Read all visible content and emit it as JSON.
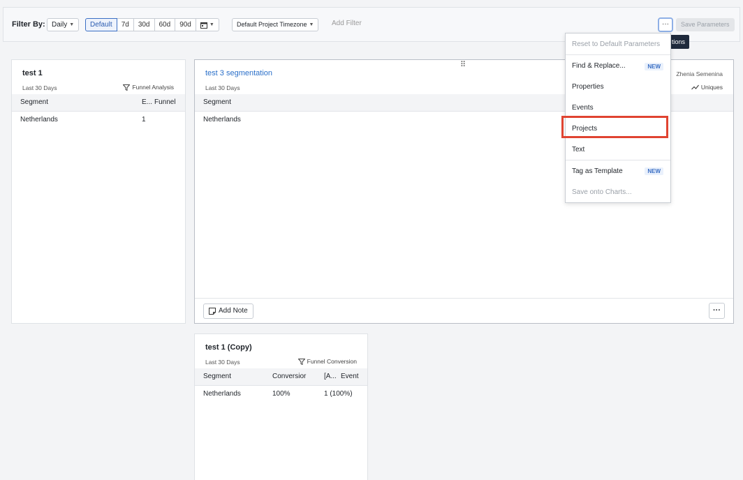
{
  "topbar": {
    "filter_label": "Filter By:",
    "interval": "Daily",
    "ranges": [
      "Default",
      "7d",
      "30d",
      "60d",
      "90d"
    ],
    "timezone": "Default Project Timezone",
    "add_filter": "Add Filter",
    "more_label": "···",
    "save_label": "Save Parameters",
    "tooltip": "tions"
  },
  "cards": {
    "c1": {
      "title": "test 1",
      "subtitle": "Last 30 Days",
      "type": "Funnel Analysis",
      "columns": [
        "Segment",
        "E...",
        "Funnel"
      ],
      "rows": [
        [
          "Netherlands",
          "1"
        ]
      ]
    },
    "c2": {
      "title": "test 3 segmentation",
      "subtitle": "Last 30 Days",
      "author": "Zhenia Semenina",
      "type": "Uniques",
      "columns": [
        "Segment"
      ],
      "rows": [
        [
          "Netherlands"
        ]
      ],
      "add_note": "Add Note",
      "more_label": "···"
    },
    "c3": {
      "title": "test 1 (Copy)",
      "subtitle": "Last 30 Days",
      "type": "Funnel Conversion",
      "columns": [
        "Segment",
        "Conversior",
        "[A...",
        "Event"
      ],
      "rows": [
        [
          "Netherlands",
          "100%",
          "1 (100%)"
        ]
      ]
    }
  },
  "menu": {
    "items": [
      {
        "label": "Reset to Default Parameters"
      },
      {
        "label": "Find & Replace...",
        "badge": "NEW"
      },
      {
        "label": "Properties"
      },
      {
        "label": "Events"
      },
      {
        "label": "Projects"
      },
      {
        "label": "Text"
      },
      {
        "label": "Tag as Template",
        "badge": "NEW"
      },
      {
        "label": "Save onto Charts..."
      }
    ]
  }
}
